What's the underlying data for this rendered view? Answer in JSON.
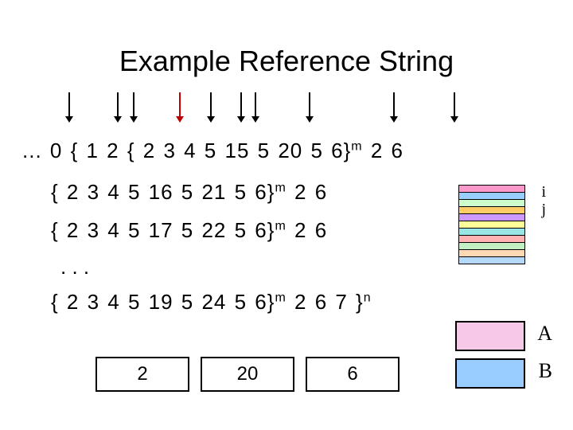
{
  "title": "Example Reference String",
  "line0": "... 0 { 1  2  { 2  3  4  5  15  5  20  5  6}",
  "line0_exp": "m",
  "line0_tail": " 2  6",
  "line1": "{ 2  3  4  5  16  5  21  5  6}",
  "line1_exp": "m",
  "line1_tail": " 2  6",
  "line2": "{ 2  3  4  5  17  5  22  5  6}",
  "line2_exp": "m",
  "line2_tail": " 2  6",
  "dots": ". . .",
  "line4": "{ 2  3  4  5  19  5  24  5  6}",
  "line4_exp": "m",
  "line4_mid": " 2  6  7 }",
  "line4_exp2": "n",
  "ij_i": "i",
  "ij_j": "j",
  "boxes": {
    "b1": "2",
    "b2": "20",
    "b3": "6"
  },
  "labels": {
    "A": "A",
    "B": "B"
  },
  "stripe_colors": [
    "#ff99cc",
    "#99ccff",
    "#ccffcc",
    "#ffcc66",
    "#cc99ff",
    "#ffff99",
    "#99e6e6",
    "#ffb3b3",
    "#c2f0c2",
    "#ffd9b3",
    "#b3d9ff"
  ],
  "arrows_x": [
    86,
    147,
    167,
    225,
    264,
    302,
    320,
    388,
    494,
    570
  ],
  "arrow_red_index": 3
}
